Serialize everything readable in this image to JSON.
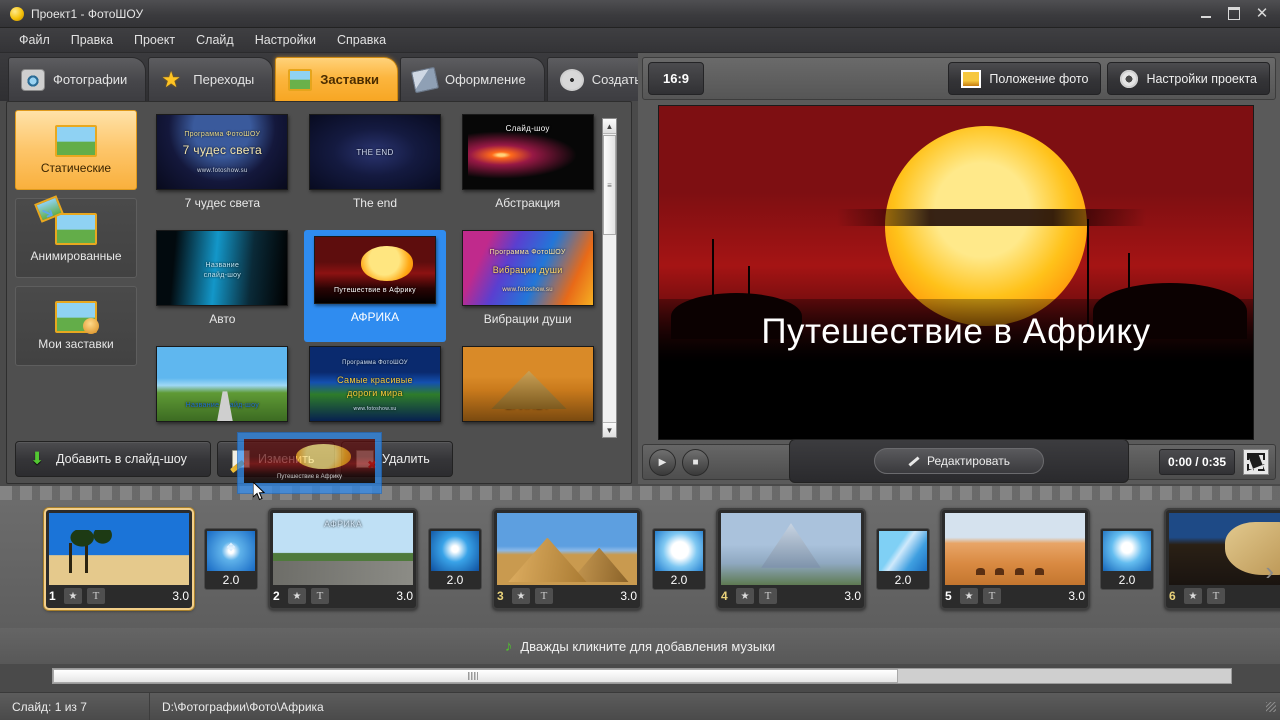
{
  "window": {
    "title": "Проект1 - ФотоШОУ",
    "minimize": "—",
    "maximize": "□",
    "close": "✕"
  },
  "menu": {
    "items": [
      {
        "label": "Файл"
      },
      {
        "label": "Правка"
      },
      {
        "label": "Проект"
      },
      {
        "label": "Слайд"
      },
      {
        "label": "Настройки"
      },
      {
        "label": "Справка"
      }
    ]
  },
  "tabs": [
    {
      "label": "Фотографии",
      "icon": "camera-icon",
      "active": false
    },
    {
      "label": "Переходы",
      "icon": "star-icon",
      "active": false
    },
    {
      "label": "Заставки",
      "icon": "picture-icon",
      "active": true
    },
    {
      "label": "Оформление",
      "icon": "brush-icon",
      "active": false
    },
    {
      "label": "Создать",
      "icon": "film-reel-icon",
      "active": false
    }
  ],
  "categories": [
    {
      "label": "Статические",
      "icon": "static-picture-icon",
      "active": true
    },
    {
      "label": "Анимированные",
      "icon": "animated-picture-icon",
      "active": false
    },
    {
      "label": "Мои заставки",
      "icon": "my-intros-icon",
      "active": false
    }
  ],
  "templates": [
    {
      "caption": "7 чудес света",
      "art": "tw-7",
      "selected": false,
      "overlay": [
        {
          "text": "Программа ФотоШОУ",
          "top": "22%",
          "color": "#e8d98a",
          "size": "7px"
        },
        {
          "text": "7 чудес света",
          "top": "38%",
          "color": "#f5e7b0",
          "size": "12px"
        },
        {
          "text": "www.fotoshow.su",
          "top": "72%",
          "color": "#cfd8e8",
          "size": "6px"
        }
      ]
    },
    {
      "caption": "The end",
      "art": "tw-end",
      "selected": false,
      "overlay": [
        {
          "text": "THE END",
          "top": "44%",
          "color": "#cfd8ee",
          "size": "8px"
        }
      ]
    },
    {
      "caption": "Абстракция",
      "art": "tw-abs",
      "selected": false,
      "overlay": [
        {
          "text": "Слайд-шоу",
          "top": "12%",
          "color": "#ffffff",
          "size": "8px"
        }
      ]
    },
    {
      "caption": "Авто",
      "art": "tw-auto2",
      "selected": false,
      "overlay": [
        {
          "text": "Название",
          "top": "42%",
          "color": "#bfe6f5",
          "size": "7px"
        },
        {
          "text": "слайд-шоу",
          "top": "56%",
          "color": "#bfe6f5",
          "size": "7px"
        }
      ]
    },
    {
      "caption": "АФРИКА",
      "art": "tw-afr",
      "selected": true,
      "overlay": [
        {
          "text": "Путешествие в Африку",
          "top": "76%",
          "color": "#ffffff",
          "size": "7px"
        }
      ]
    },
    {
      "caption": "Вибрации души",
      "art": "tw-vib",
      "selected": false,
      "overlay": [
        {
          "text": "Программа ФотоШОУ",
          "top": "24%",
          "color": "#ffe9a8",
          "size": "7px"
        },
        {
          "text": "Вибрации души",
          "top": "46%",
          "color": "#ffd76a",
          "size": "9px"
        },
        {
          "text": "www.fotoshow.su",
          "top": "76%",
          "color": "#ffe0b0",
          "size": "6px"
        }
      ]
    },
    {
      "caption": "",
      "art": "tw-road",
      "selected": false,
      "overlay": [
        {
          "text": "Название слайд-шоу",
          "top": "74%",
          "color": "#1f6fd0",
          "size": "7px"
        }
      ]
    },
    {
      "caption": "",
      "art": "tw-dor",
      "selected": false,
      "overlay": [
        {
          "text": "Программа ФотоШОУ",
          "top": "18%",
          "color": "#cfe0f5",
          "size": "6px"
        },
        {
          "text": "Самые красивые",
          "top": "38%",
          "color": "#f5c83a",
          "size": "9px"
        },
        {
          "text": "дороги мира",
          "top": "56%",
          "color": "#f5c83a",
          "size": "9px"
        },
        {
          "text": "www.fotoshow.su",
          "top": "80%",
          "color": "#cfe0f5",
          "size": "5px"
        }
      ]
    },
    {
      "caption": "",
      "art": "tw-egy",
      "selected": false,
      "overlay": [
        {
          "text": "ЕГИПЕТ",
          "top": "72%",
          "color": "#fff0c0",
          "size": "11px"
        }
      ]
    }
  ],
  "editor_toolbar": [
    {
      "label": "Добавить в слайд-шоу",
      "icon": "green-down-arrow-icon"
    },
    {
      "label": "Изменить",
      "icon": "pencil-icon"
    },
    {
      "label": "Удалить",
      "icon": "delete-icon"
    }
  ],
  "drag_ghost": {
    "label": "Путешествие в Африку",
    "source_action": "Создать"
  },
  "preview": {
    "aspect_ratio": "16:9",
    "photo_position_button": "Положение фото",
    "project_settings_button": "Настройки проекта",
    "stage_title": "Путешествие в Африку",
    "play_icon": "▶",
    "stop_icon": "■",
    "edit_button": "Редактировать",
    "timecode": "0:00 / 0:35",
    "fullscreen_icon": "fullscreen-icon"
  },
  "timeline": {
    "slides": [
      {
        "number": "1",
        "duration": "3.0",
        "art": "a-palm",
        "selected": true,
        "highlight_number": false,
        "label": ""
      },
      {
        "number": "2",
        "duration": "3.0",
        "art": "a-road",
        "selected": false,
        "highlight_number": false,
        "label": "АФРИКА"
      },
      {
        "number": "3",
        "duration": "3.0",
        "art": "a-pyr",
        "selected": false,
        "highlight_number": true,
        "label": ""
      },
      {
        "number": "4",
        "duration": "3.0",
        "art": "a-mtn",
        "selected": false,
        "highlight_number": true,
        "label": ""
      },
      {
        "number": "5",
        "duration": "3.0",
        "art": "a-dune",
        "selected": false,
        "highlight_number": false,
        "label": ""
      },
      {
        "number": "6",
        "duration": "",
        "art": "a-leop",
        "selected": false,
        "highlight_number": true,
        "label": ""
      }
    ],
    "transitions": [
      {
        "duration": "2.0",
        "art": "tr-a",
        "icon": "✥"
      },
      {
        "duration": "2.0",
        "art": "tr-b",
        "icon": ""
      },
      {
        "duration": "2.0",
        "art": "tr-c",
        "icon": ""
      },
      {
        "duration": "2.0",
        "art": "tr-d",
        "icon": ""
      },
      {
        "duration": "2.0",
        "art": "tr-e",
        "icon": ""
      }
    ],
    "star_icon": "★",
    "text_icon": "T",
    "next_arrow": "›"
  },
  "music": {
    "hint": "Дважды кликните для добавления музыки",
    "icon": "music-note-icon"
  },
  "status": {
    "slide_counter": "Слайд: 1 из 7",
    "path": "D:\\Фотографии\\Фото\\Африка"
  },
  "colors": {
    "accent": "#f7a623",
    "selection": "#2f8cf0",
    "panel": "#4f4f4f",
    "chrome": "#5a5a5a"
  }
}
